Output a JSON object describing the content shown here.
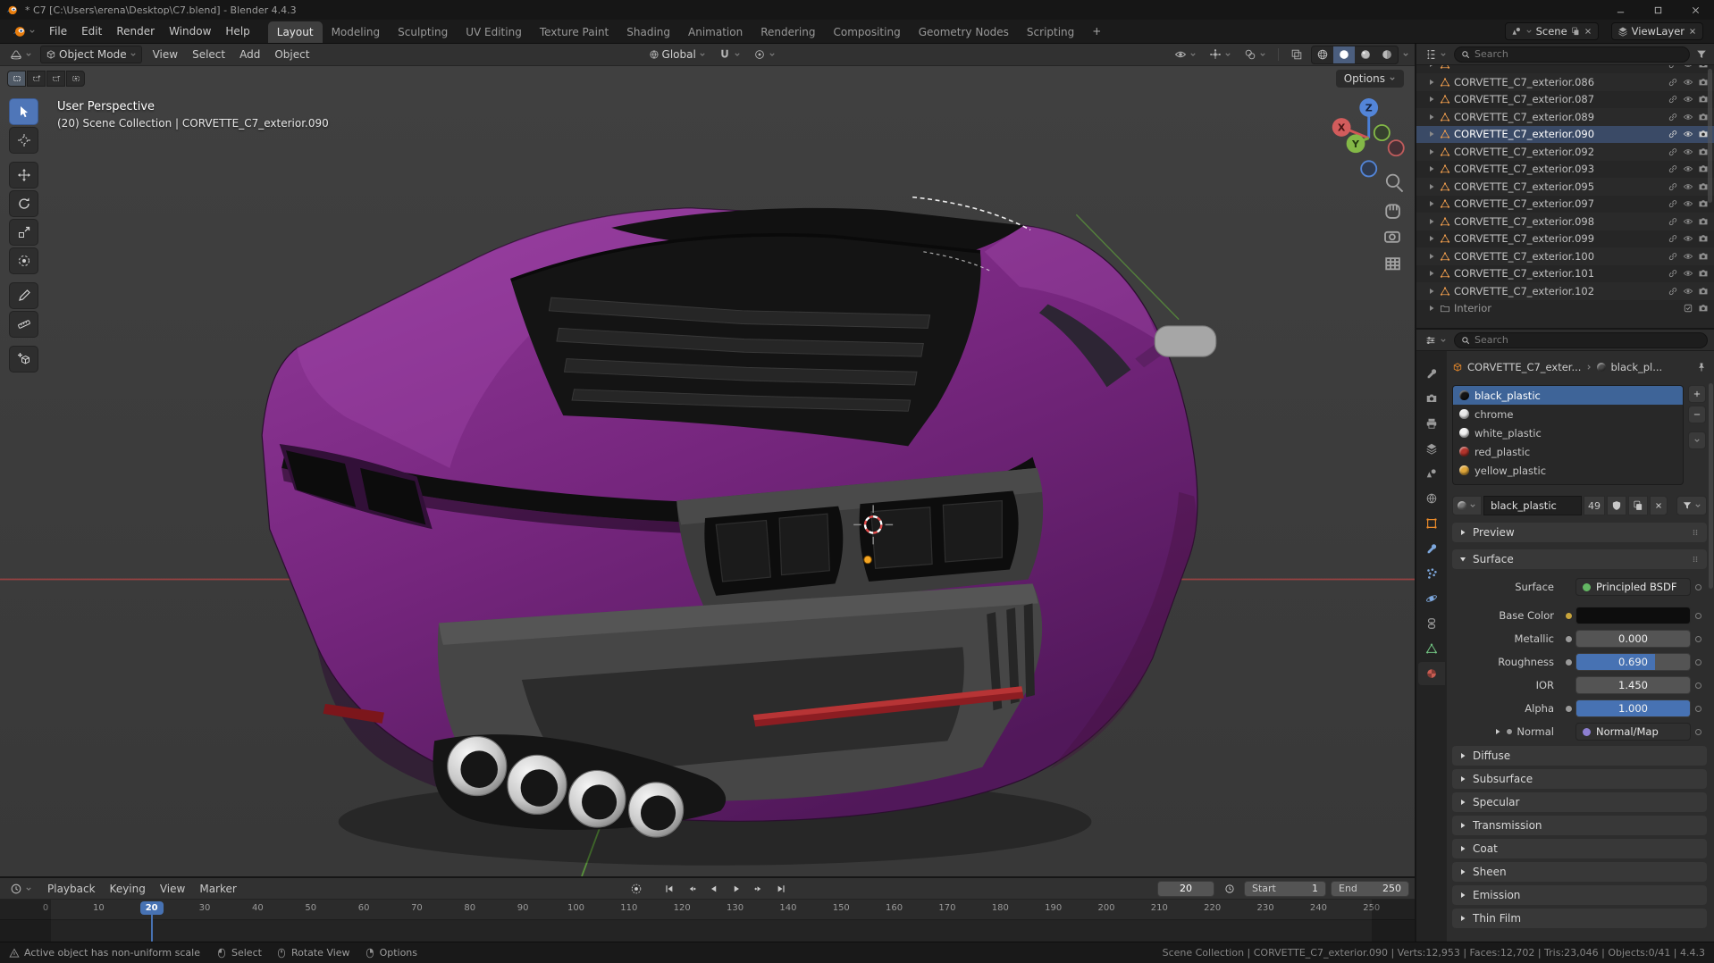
{
  "colors": {
    "accent": "#4772b3",
    "orange": "#e87d0d",
    "car_body": "#76267e",
    "selection_blue": "#3e6498"
  },
  "titlebar": {
    "title": "* C7 [C:\\Users\\erena\\Desktop\\C7.blend] - Blender 4.4.3"
  },
  "menubar": {
    "menus": [
      {
        "label": "File"
      },
      {
        "label": "Edit"
      },
      {
        "label": "Render"
      },
      {
        "label": "Window"
      },
      {
        "label": "Help"
      }
    ],
    "workspaces": [
      {
        "label": "Layout",
        "active": true
      },
      {
        "label": "Modeling"
      },
      {
        "label": "Sculpting"
      },
      {
        "label": "UV Editing"
      },
      {
        "label": "Texture Paint"
      },
      {
        "label": "Shading"
      },
      {
        "label": "Animation"
      },
      {
        "label": "Rendering"
      },
      {
        "label": "Compositing"
      },
      {
        "label": "Geometry Nodes"
      },
      {
        "label": "Scripting"
      }
    ],
    "add_workspace_label": "+",
    "scene_selector": {
      "label": "Scene"
    },
    "viewlayer_selector": {
      "label": "ViewLayer"
    }
  },
  "viewport": {
    "header": {
      "mode": "Object Mode",
      "menus": [
        {
          "label": "View"
        },
        {
          "label": "Select"
        },
        {
          "label": "Add"
        },
        {
          "label": "Object"
        }
      ],
      "orientation": "Global",
      "options_label": "Options"
    },
    "overlay": {
      "perspective_label": "User Perspective",
      "context_label": "(20) Scene Collection | CORVETTE_C7_exterior.090"
    },
    "gizmo_axes": [
      "X",
      "Y",
      "Z"
    ]
  },
  "toolbar": {
    "tools": [
      {
        "name": "tool-select-box",
        "icon": "tool-select",
        "active": true
      },
      {
        "name": "tool-cursor",
        "icon": "tool-cursor"
      },
      {
        "name": "tool-move",
        "icon": "tool-move"
      },
      {
        "name": "tool-rotate",
        "icon": "tool-rotate"
      },
      {
        "name": "tool-scale",
        "icon": "tool-scale"
      },
      {
        "name": "tool-transform",
        "icon": "tool-transform"
      },
      {
        "name": "tool-annotate",
        "icon": "tool-annotate"
      },
      {
        "name": "tool-measure",
        "icon": "tool-measure"
      },
      {
        "name": "tool-add-cube",
        "icon": "tool-addcube"
      }
    ]
  },
  "outliner": {
    "search_placeholder": "Search",
    "items": [
      {
        "label": "CORVETTE_C7_exterior.086"
      },
      {
        "label": "CORVETTE_C7_exterior.087"
      },
      {
        "label": "CORVETTE_C7_exterior.089"
      },
      {
        "label": "CORVETTE_C7_exterior.090",
        "active": true
      },
      {
        "label": "CORVETTE_C7_exterior.092"
      },
      {
        "label": "CORVETTE_C7_exterior.093"
      },
      {
        "label": "CORVETTE_C7_exterior.095"
      },
      {
        "label": "CORVETTE_C7_exterior.097"
      },
      {
        "label": "CORVETTE_C7_exterior.098"
      },
      {
        "label": "CORVETTE_C7_exterior.099"
      },
      {
        "label": "CORVETTE_C7_exterior.100"
      },
      {
        "label": "CORVETTE_C7_exterior.101"
      },
      {
        "label": "CORVETTE_C7_exterior.102"
      }
    ],
    "collection_item": {
      "label": "Interior"
    }
  },
  "properties": {
    "search_placeholder": "Search",
    "tabs": [
      {
        "name": "tab-tool",
        "icon": "tool-icon"
      },
      {
        "name": "tab-render",
        "icon": "render-icon"
      },
      {
        "name": "tab-output",
        "icon": "output-icon"
      },
      {
        "name": "tab-view-layer",
        "icon": "viewlayer-icon"
      },
      {
        "name": "tab-scene",
        "icon": "scene-icon"
      },
      {
        "name": "tab-world",
        "icon": "world-icon"
      },
      {
        "name": "tab-object",
        "icon": "object-icon"
      },
      {
        "name": "tab-modifiers",
        "icon": "modifiers-icon"
      },
      {
        "name": "tab-particles",
        "icon": "particles-icon"
      },
      {
        "name": "tab-physics",
        "icon": "physics-icon"
      },
      {
        "name": "tab-constraints",
        "icon": "constraints-icon"
      },
      {
        "name": "tab-object-data",
        "icon": "data-icon"
      },
      {
        "name": "tab-material",
        "icon": "material-icon",
        "active": true
      }
    ],
    "breadcrumb": {
      "object": "CORVETTE_C7_exter...",
      "material": "black_pl..."
    },
    "material_slots": [
      {
        "label": "black_plastic",
        "color": "#141414",
        "selected": true
      },
      {
        "label": "chrome",
        "color": "#e8e8e8"
      },
      {
        "label": "white_plastic",
        "color": "#f2f2f2"
      },
      {
        "label": "red_plastic",
        "color": "#b3342c"
      },
      {
        "label": "yellow_plastic",
        "color": "#e0a73a"
      }
    ],
    "datablock": {
      "name": "black_plastic",
      "users": "49"
    },
    "panels": {
      "preview": "Preview",
      "surface": "Surface"
    },
    "surface_props": {
      "surface": {
        "label": "Surface",
        "value": "Principled BSDF"
      },
      "base_color": {
        "label": "Base Color"
      },
      "metallic": {
        "label": "Metallic",
        "value": "0.000",
        "fill": 0
      },
      "roughness": {
        "label": "Roughness",
        "value": "0.690",
        "fill": 0.69
      },
      "ior": {
        "label": "IOR",
        "value": "1.450",
        "fill": 0
      },
      "alpha": {
        "label": "Alpha",
        "value": "1.000",
        "fill": 1
      },
      "normal": {
        "label": "Normal",
        "value": "Normal/Map"
      }
    },
    "collapsed_panels": [
      {
        "label": "Diffuse"
      },
      {
        "label": "Subsurface"
      },
      {
        "label": "Specular"
      },
      {
        "label": "Transmission"
      },
      {
        "label": "Coat"
      },
      {
        "label": "Sheen"
      },
      {
        "label": "Emission"
      },
      {
        "label": "Thin Film"
      }
    ]
  },
  "timeline": {
    "menus": [
      {
        "label": "Playback"
      },
      {
        "label": "Keying"
      },
      {
        "label": "View"
      },
      {
        "label": "Marker"
      }
    ],
    "current_frame": "20",
    "frame_start": {
      "label": "Start",
      "value": "1"
    },
    "frame_end": {
      "label": "End",
      "value": "250"
    },
    "ticks": [
      "0",
      "10",
      "20",
      "30",
      "40",
      "50",
      "60",
      "70",
      "80",
      "90",
      "100",
      "110",
      "120",
      "130",
      "140",
      "150",
      "160",
      "170",
      "180",
      "190",
      "200",
      "210",
      "220",
      "230",
      "240",
      "250"
    ]
  },
  "statusbar": {
    "warning": "Active object has non-uniform scale",
    "hints": [
      {
        "icon": "mouse-left",
        "label": "Select"
      },
      {
        "icon": "mouse-middle",
        "label": "Rotate View"
      },
      {
        "icon": "mouse-right",
        "label": "Options"
      }
    ],
    "stats": "Scene Collection | CORVETTE_C7_exterior.090 | Verts:12,953 | Faces:12,702 | Tris:23,046 | Objects:0/41 | 4.4.3"
  }
}
